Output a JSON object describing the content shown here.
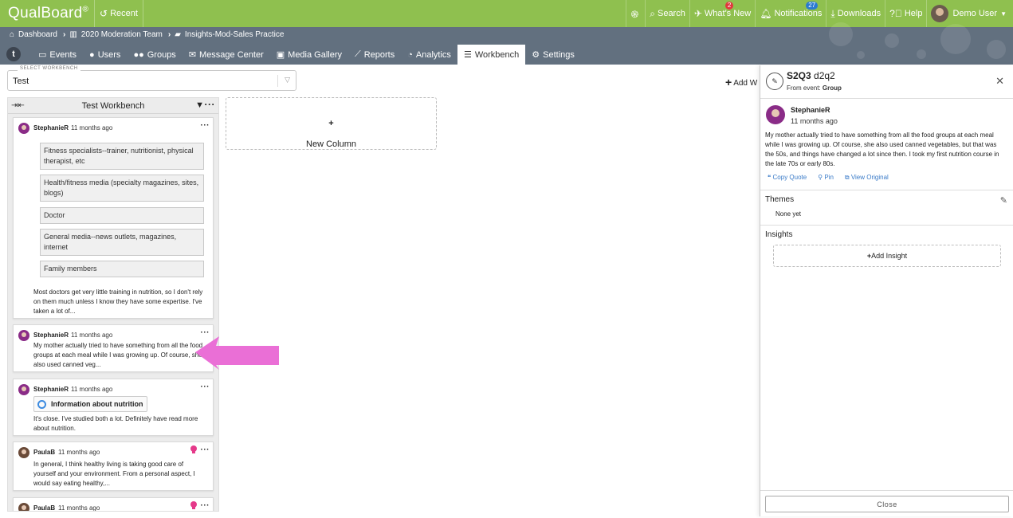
{
  "app": {
    "logo": "QualBoard",
    "logo_mark": "®",
    "recent": "Recent"
  },
  "topbar": {
    "items": [
      {
        "label": "",
        "icon": "fingerprint-icon"
      },
      {
        "label": "Search",
        "icon": "search-icon"
      },
      {
        "label": "What's New",
        "icon": "megaphone-icon",
        "badge": "2"
      },
      {
        "label": "Notifications",
        "icon": "bell-icon",
        "badge": "27"
      },
      {
        "label": "Downloads",
        "icon": "download-icon"
      },
      {
        "label": "Help",
        "icon": "help-icon"
      },
      {
        "label": "Demo User",
        "icon": "avatar"
      }
    ]
  },
  "breadcrumb": {
    "home": "Dashboard",
    "team": "2020 Moderation Team",
    "project": "Insights-Mod-Sales Practice"
  },
  "tabs": [
    "Events",
    "Users",
    "Groups",
    "Message Center",
    "Media Gallery",
    "Reports",
    "Analytics",
    "Workbench",
    "Settings"
  ],
  "active_tab": "Workbench",
  "select": {
    "label": "SELECT WORKBENCH",
    "value": "Test"
  },
  "add_workbench": "Add W",
  "column": {
    "title": "Test Workbench",
    "cards": [
      {
        "user": "StephanieR",
        "time": "11 months ago",
        "options": [
          "Fitness specialists--trainer, nutritionist, physical therapist, etc",
          "Health/fitness media (specialty magazines, sites, blogs)",
          "Doctor",
          "General media--news outlets, magazines, internet",
          "Family members"
        ],
        "text": "Most doctors get very little training in nutrition, so I don't rely on them much unless I know they have some expertise. I've taken a lot of..."
      },
      {
        "user": "StephanieR",
        "time": "11 months ago",
        "text": "My mother actually tried to have something from all the food groups at each meal while I was growing up. Of course, she also used canned veg..."
      },
      {
        "user": "StephanieR",
        "time": "11 months ago",
        "theme": "Information about nutrition",
        "text": "It's close. I've studied both a lot. Definitely have read more about nutrition."
      },
      {
        "user": "PaulaB",
        "time": "11 months ago",
        "text": "In general, I think healthy living is taking good care of yourself and your environment. From a personal aspect, I would say eating healthy,..."
      },
      {
        "user": "PaulaB",
        "time": "11 months ago",
        "text": ""
      }
    ]
  },
  "new_column": "New Column",
  "panel": {
    "title_bold": "S2Q3",
    "title_rest": "d2q2",
    "from_label": "From event:",
    "from_value": "Group",
    "user": "StephanieR",
    "time": "11 months ago",
    "text": "My mother actually tried to have something from all the food groups at each meal while I was growing up. Of course, she also used canned vegetables, but that was the 50s, and things have changed a lot since then. I took my first nutrition course in the late 70s or early 80s.",
    "actions": [
      "Copy Quote",
      "Pin",
      "View Original"
    ],
    "themes_label": "Themes",
    "themes_value": "None yet",
    "insights_label": "Insights",
    "add_insight": "Add Insight",
    "close": "Close"
  },
  "colors": {
    "topbar": "#8fc04f",
    "nav": "#62707f",
    "link": "#3a7bc8",
    "arrow": "#ea6fd6",
    "badge_red": "#e0383e",
    "badge_blue": "#2b7bd0"
  }
}
